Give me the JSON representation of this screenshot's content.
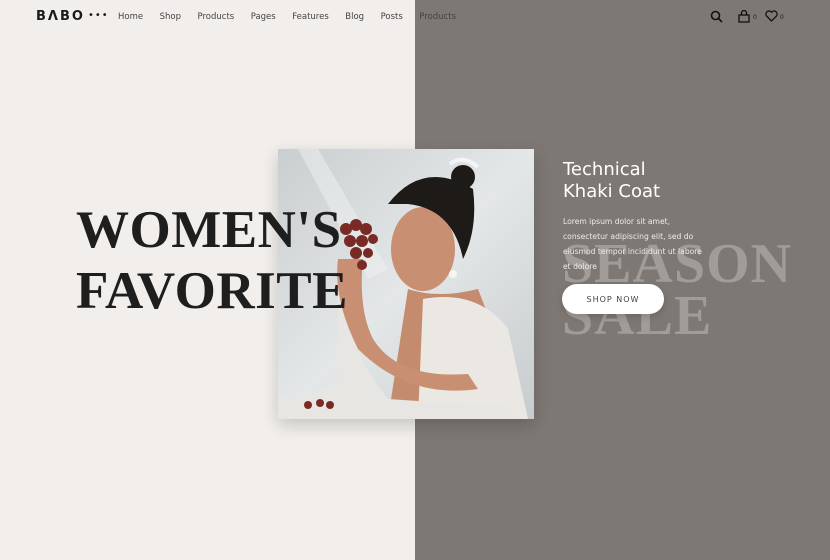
{
  "header": {
    "logo": "BΛBO",
    "more_label": "•••",
    "nav": [
      "Home",
      "Shop",
      "Products",
      "Pages",
      "Features",
      "Blog",
      "Posts",
      "Products"
    ],
    "cart_count": "0",
    "wishlist_count": "0"
  },
  "hero": {
    "title_line1": "WOMEN'S",
    "title_line2": "FAVORITE",
    "background_word1": "SEASON",
    "background_word2": "SALE",
    "product_title_line1": "Technical",
    "product_title_line2": "Khaki Coat",
    "description": "Lorem ipsum dolor sit amet, consectetur adipiscing elit, sed do eiusmod tempor incididunt ut labore et dolore",
    "cta_label": "SHOP NOW"
  },
  "colors": {
    "left_bg": "#f2eeeb",
    "right_bg": "#7e7874",
    "title": "#1e1e1e"
  }
}
